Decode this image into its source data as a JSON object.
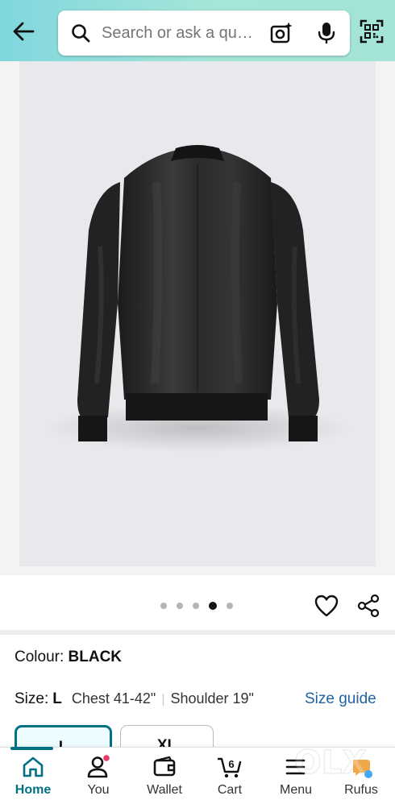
{
  "header": {
    "search_placeholder": "Search or ask a qu…"
  },
  "gallery": {
    "image_count": 5,
    "active_index": 3
  },
  "product": {
    "colour_label": "Colour:",
    "colour_value": "BLACK",
    "size_label": "Size:",
    "size_value": "L",
    "chest": "Chest 41-42\"",
    "separator": "|",
    "shoulder": "Shoulder 19\"",
    "size_guide": "Size guide",
    "size_options": [
      "L",
      "XL"
    ]
  },
  "nav": {
    "items": [
      {
        "label": "Home",
        "icon": "home-icon"
      },
      {
        "label": "You",
        "icon": "person-icon"
      },
      {
        "label": "Wallet",
        "icon": "wallet-icon"
      },
      {
        "label": "Cart",
        "icon": "cart-icon"
      },
      {
        "label": "Menu",
        "icon": "menu-icon"
      },
      {
        "label": "Rufus",
        "icon": "rufus-icon"
      }
    ],
    "cart_count": "6"
  },
  "watermark": "OLX",
  "colors": {
    "header_gradient_start": "#80d7de",
    "header_gradient_end": "#a3e4d7",
    "accent": "#007185",
    "link": "#2162a1",
    "notification": "#e53b63"
  }
}
